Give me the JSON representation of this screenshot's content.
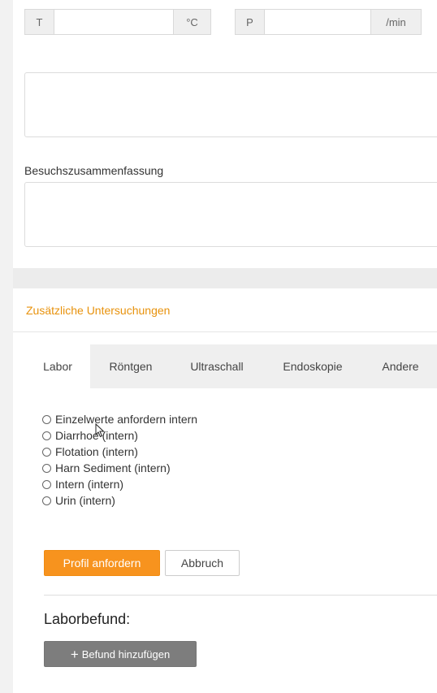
{
  "vitals": {
    "temp_label": "T",
    "temp_unit": "°C",
    "pulse_label": "P",
    "pulse_unit": "/min"
  },
  "summary": {
    "label": "Besuchszusammenfassung"
  },
  "additional": {
    "title": "Zusätzliche Untersuchungen",
    "tabs": [
      "Labor",
      "Röntgen",
      "Ultraschall",
      "Endoskopie",
      "Andere"
    ],
    "options": [
      "Einzelwerte anfordern intern",
      "Diarrhoe (intern)",
      "Flotation (intern)",
      "Harn Sediment (intern)",
      "Intern (intern)",
      "Urin (intern)"
    ],
    "request_button": "Profil anfordern",
    "cancel_button": "Abbruch",
    "lab_heading": "Laborbefund:",
    "add_finding_button": "Befund hinzufügen"
  },
  "icons": {
    "plus": "plus-icon",
    "cursor": "mouse-pointer-icon"
  },
  "colors": {
    "accent": "#f7931e",
    "section_title": "#e8920c",
    "add_button": "#7d7d7d"
  }
}
